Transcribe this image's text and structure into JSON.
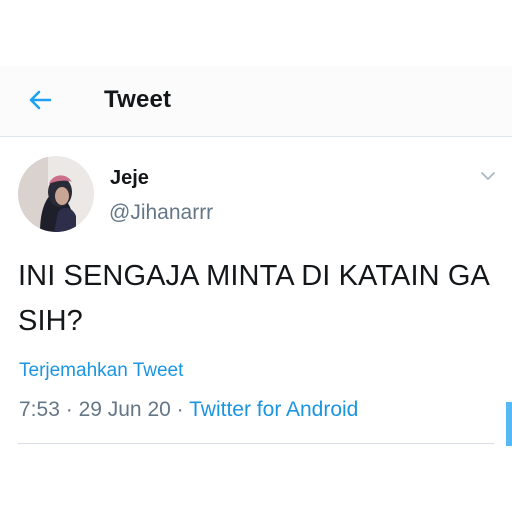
{
  "header": {
    "title": "Tweet",
    "back_icon": "arrow-left-icon"
  },
  "tweet": {
    "author": {
      "display_name": "Jeje",
      "handle": "@Jihanarrr"
    },
    "menu_icon": "chevron-down-icon",
    "text": "INI SENGAJA MINTA DI KATAIN GA SIH?",
    "translate_label": "Terjemahkan Tweet",
    "time": "7:53",
    "date": "29 Jun 20",
    "separator": "·",
    "source": "Twitter for Android"
  },
  "colors": {
    "accent": "#1da1f2",
    "link": "#1b95e0",
    "secondary_text": "#657786",
    "primary_text": "#14171a"
  }
}
